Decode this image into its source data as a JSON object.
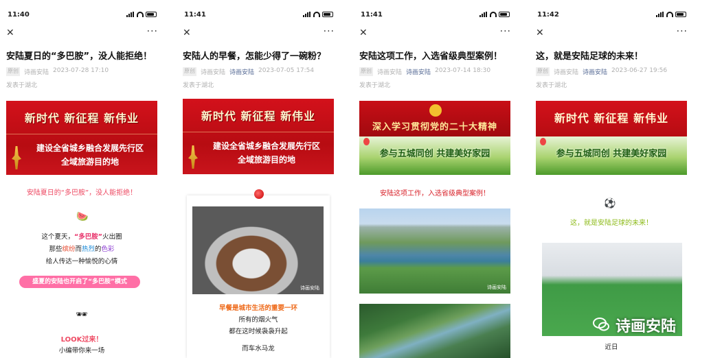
{
  "panels": [
    {
      "time": "11:40",
      "title": "安陆夏日的“多巴胺”，没人能拒绝！",
      "tag": "原创",
      "author": "诗画安陆",
      "account": "",
      "date": "2023-07-28 17:10",
      "location": "发表于湖北",
      "banner_big": "新时代  新征程  新伟业",
      "banner_sub1": "建设全省城乡融合发展先行区",
      "banner_sub2": "全域旅游目的地",
      "section_title": "安陆夏日的“多巴胺”，没人能拒绝！",
      "lines": [
        "这个夏天，“多巴胺”火出圈",
        "那些缤纷而热烈的色彩",
        "给人传达一种愉悦的心情"
      ],
      "line1_a": "这个夏天，",
      "line1_b": "“多巴胺”",
      "line1_c": "火出圈",
      "line2_a": "那些",
      "line2_b": "缤纷",
      "line2_c": "而",
      "line2_d": "热烈",
      "line2_e": "的",
      "line2_f": "色彩",
      "line3": "给人传达一种愉悦的心情",
      "pill": "盛夏的安陆也开启了“多巴胺”模式",
      "look": "LOOK过来！",
      "footer": "小编带你来一场"
    },
    {
      "time": "11:41",
      "title": "安陆人的早餐，怎能少得了一碗粉？",
      "tag": "原创",
      "author": "诗画安陆",
      "account": "诗画安陆",
      "date": "2023-07-05 17:54",
      "location": "发表于湖北",
      "banner_big": "新时代  新征程  新伟业",
      "banner_sub1": "建设全省城乡融合发展先行区",
      "banner_sub2": "全域旅游目的地",
      "photo_watermark": "诗画安陆",
      "caption_title": "早餐是城市生活的重要一环",
      "caption_lines": [
        "所有的烟火气",
        "都在这时候袅袅升起",
        "而车水马龙"
      ]
    },
    {
      "time": "11:41",
      "title": "安陆这项工作，入选省级典型案例！",
      "tag": "原创",
      "author": "诗画安陆",
      "account": "诗画安陆",
      "date": "2023-07-14 18:30",
      "location": "发表于湖北",
      "banner_top": "深入学习贯彻党的二十大精神",
      "banner_bottom": "参与五城同创  共建美好家园",
      "section_title": "安陆这项工作，入选省级典型案例！",
      "photo_watermark": "诗画安陆"
    },
    {
      "time": "11:42",
      "title": "这，就是安陆足球的未来！",
      "tag": "原创",
      "author": "诗画安陆",
      "account": "诗画安陆",
      "date": "2023-06-27 19:56",
      "location": "发表于湖北",
      "banner_big": "新时代  新征程  新伟业",
      "banner_bottom": "参与五城同创  共建美好家园",
      "section_title": "这，就是安陆足球的未来！",
      "footer": "近日"
    }
  ],
  "overlay_watermark": "诗画安陆",
  "icons": {
    "close": "close-icon",
    "more": "more-icon"
  },
  "colors": {
    "banner_red": "#c80e16",
    "pink": "#ee4a63",
    "green_title": "#8dbb19",
    "link": "#576b95"
  }
}
